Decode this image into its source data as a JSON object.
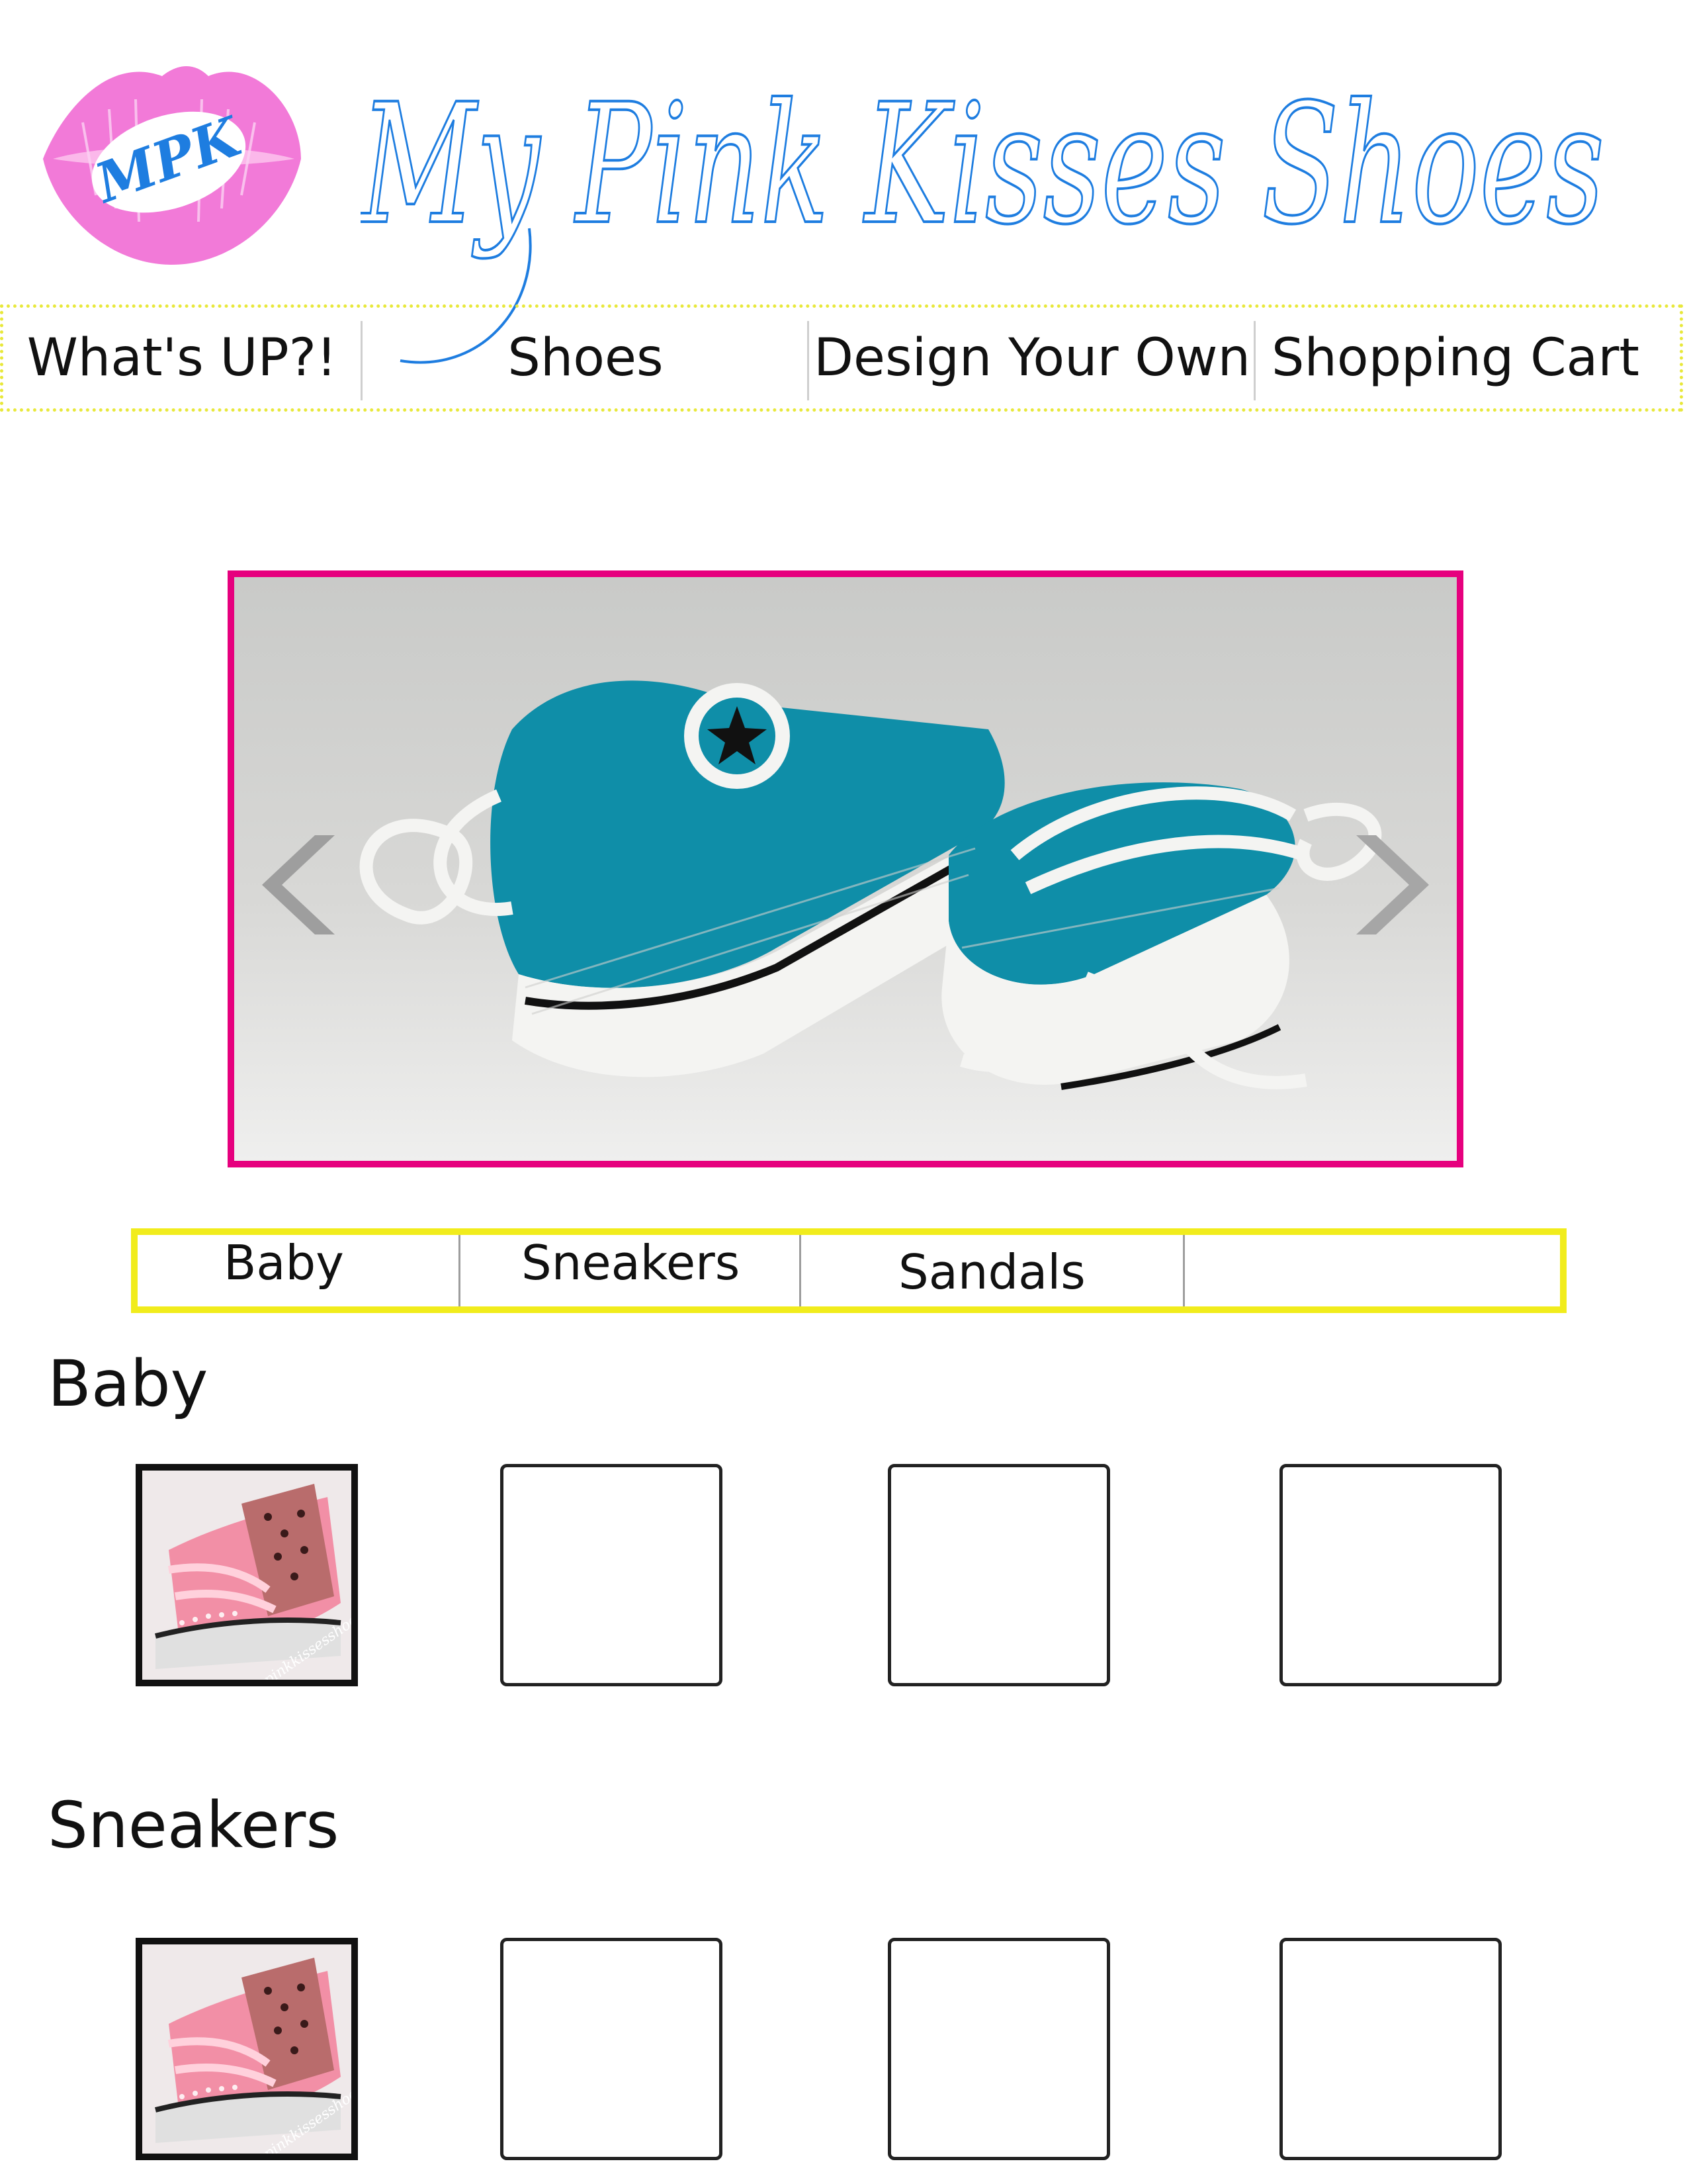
{
  "header": {
    "logo_text": "MPK",
    "site_title": "My Pink Kisses Shoes"
  },
  "nav": {
    "items": [
      {
        "label": "What's UP?!"
      },
      {
        "label": "Shoes"
      },
      {
        "label": "Design Your Own"
      },
      {
        "label": "Shopping Cart"
      }
    ]
  },
  "slider": {
    "prev_icon": "chevron-left-icon",
    "next_icon": "chevron-right-icon"
  },
  "categories": {
    "tabs": [
      {
        "label": "Baby"
      },
      {
        "label": "Sneakers"
      },
      {
        "label": "Sandals"
      },
      {
        "label": ""
      }
    ]
  },
  "sections": [
    {
      "title": "Baby",
      "thumb_watermark": "@Mypinkkissesshoes"
    },
    {
      "title": "Sneakers",
      "thumb_watermark": "@Mypinkkissesshoes"
    }
  ],
  "colors": {
    "brand_blue": "#1e7de0",
    "brand_pink": "#f27ad8",
    "slider_border": "#e6007e",
    "accent_yellow": "#f1ec1c"
  }
}
